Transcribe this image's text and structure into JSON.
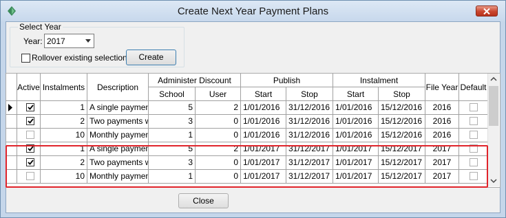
{
  "window": {
    "title": "Create Next Year Payment Plans"
  },
  "select_year": {
    "group_title": "Select Year",
    "year_label": "Year:",
    "year_value": "2017",
    "rollover_label": "Rollover existing selections",
    "rollover_checked": false,
    "create_label": "Create"
  },
  "table": {
    "headers": {
      "active": "Active",
      "instalments": "Instalments",
      "description": "Description",
      "administer_discount": "Administer Discount",
      "school": "School",
      "user": "User",
      "publish": "Publish",
      "publish_start": "Start",
      "publish_stop": "Stop",
      "instalment": "Instalment",
      "instalment_start": "Start",
      "instalment_stop": "Stop",
      "file_year": "File Year",
      "default": "Default"
    },
    "rows": [
      {
        "active": true,
        "instalments": "1",
        "description": "A single payment",
        "school": "5",
        "user": "2",
        "pub_start": "1/01/2016",
        "pub_stop": "31/12/2016",
        "inst_start": "1/01/2016",
        "inst_stop": "15/12/2016",
        "file_year": "2016",
        "default": false,
        "current": true
      },
      {
        "active": true,
        "instalments": "2",
        "description": "Two payments wit",
        "school": "3",
        "user": "0",
        "pub_start": "1/01/2016",
        "pub_stop": "31/12/2016",
        "inst_start": "1/01/2016",
        "inst_stop": "15/12/2016",
        "file_year": "2016",
        "default": false,
        "current": false
      },
      {
        "active": false,
        "instalments": "10",
        "description": "Monthly payments",
        "school": "1",
        "user": "0",
        "pub_start": "1/01/2016",
        "pub_stop": "31/12/2016",
        "inst_start": "1/01/2016",
        "inst_stop": "15/12/2016",
        "file_year": "2016",
        "default": false,
        "current": false
      },
      {
        "active": true,
        "instalments": "1",
        "description": "A single payment",
        "school": "5",
        "user": "2",
        "pub_start": "1/01/2017",
        "pub_stop": "31/12/2017",
        "inst_start": "1/01/2017",
        "inst_stop": "15/12/2017",
        "file_year": "2017",
        "default": false,
        "current": false
      },
      {
        "active": true,
        "instalments": "2",
        "description": "Two payments wit",
        "school": "3",
        "user": "0",
        "pub_start": "1/01/2017",
        "pub_stop": "31/12/2017",
        "inst_start": "1/01/2017",
        "inst_stop": "15/12/2017",
        "file_year": "2017",
        "default": false,
        "current": false
      },
      {
        "active": false,
        "instalments": "10",
        "description": "Monthly payments",
        "school": "1",
        "user": "0",
        "pub_start": "1/01/2017",
        "pub_stop": "31/12/2017",
        "inst_start": "1/01/2017",
        "inst_stop": "15/12/2017",
        "file_year": "2017",
        "default": false,
        "current": false
      }
    ]
  },
  "footer": {
    "close_label": "Close"
  },
  "colors": {
    "highlight": "#e0232a",
    "title_bar": "#c7d8ec",
    "close_button": "#c9452d"
  },
  "icons": [
    "app-icon",
    "close-icon",
    "dropdown-arrow-icon",
    "scroll-up-icon",
    "scroll-down-icon",
    "row-pointer-icon",
    "checkmark-icon"
  ]
}
